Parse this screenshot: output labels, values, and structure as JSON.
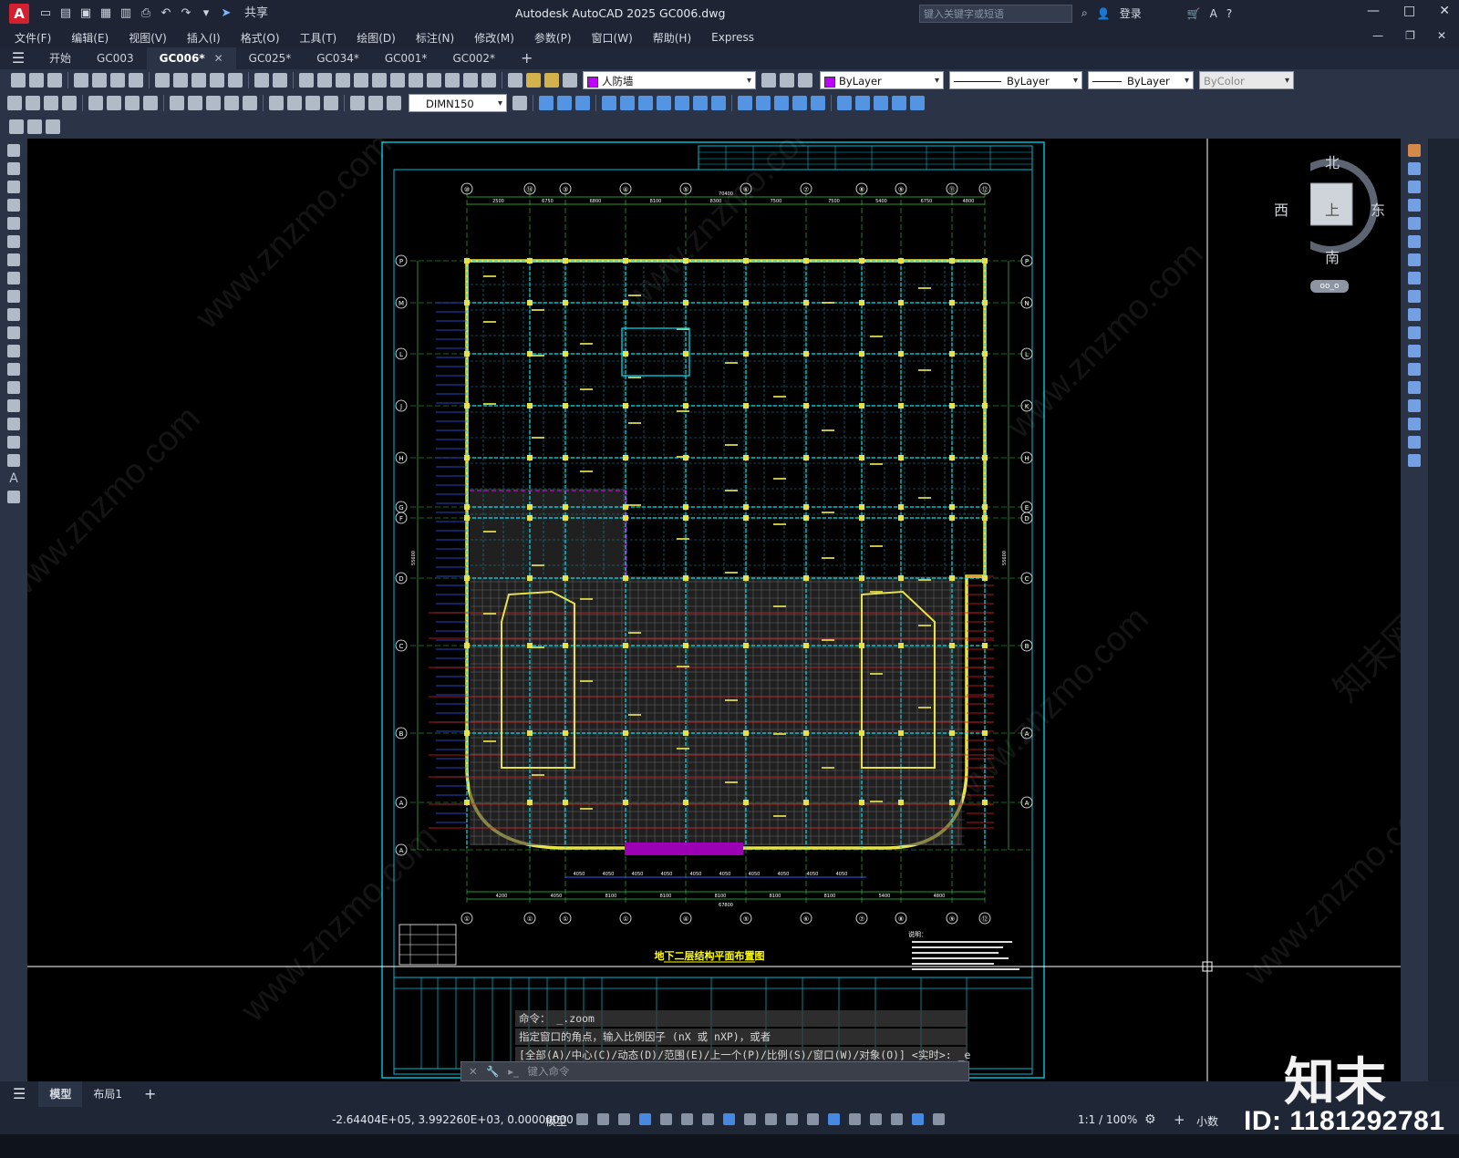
{
  "app": {
    "logo": "A",
    "title": "Autodesk AutoCAD 2025    GC006.dwg",
    "share": "共享",
    "search_placeholder": "键入关键字或短语",
    "login": "登录"
  },
  "menu": [
    "文件(F)",
    "编辑(E)",
    "视图(V)",
    "插入(I)",
    "格式(O)",
    "工具(T)",
    "绘图(D)",
    "标注(N)",
    "修改(M)",
    "参数(P)",
    "窗口(W)",
    "帮助(H)",
    "Express"
  ],
  "tabs": [
    {
      "label": "开始",
      "active": false
    },
    {
      "label": "GC003",
      "active": false
    },
    {
      "label": "GC006*",
      "active": true
    },
    {
      "label": "GC025*",
      "active": false
    },
    {
      "label": "GC034*",
      "active": false
    },
    {
      "label": "GC001*",
      "active": false
    },
    {
      "label": "GC002*",
      "active": false
    }
  ],
  "properties": {
    "layer": "人防墙",
    "color": "ByLayer",
    "linetype": "ByLayer",
    "lineweight": "ByLayer",
    "plotstyle": "ByColor",
    "dimstyle": "DIMN150"
  },
  "viewcube": {
    "north": "北",
    "south": "南",
    "east": "东",
    "west": "西",
    "top": "上",
    "wcs": "oo_o"
  },
  "drawing": {
    "title": "地下二层结构平面布置图",
    "grid_top": [
      "⑩",
      "⑭",
      "③",
      "④",
      "⑤",
      "⑥",
      "⑦",
      "⑧",
      "⑨",
      "⑪",
      "⑫"
    ],
    "grid_bottom": [
      "①",
      "①",
      "①",
      "①",
      "④",
      "⑤",
      "⑥",
      "⑦",
      "⑧",
      "⑨",
      "⑫"
    ],
    "grid_left": [
      "P",
      "M",
      "L",
      "J",
      "H",
      "G",
      "F",
      "D",
      "C",
      "B",
      "A",
      "A"
    ],
    "grid_right": [
      "P",
      "N",
      "L",
      "K",
      "H",
      "E",
      "D",
      "C",
      "B",
      "A",
      "A"
    ],
    "dim_top": [
      "2500",
      "6750",
      "6800",
      "8100",
      "8300",
      "7500",
      "7500",
      "5400",
      "6750",
      "4800"
    ],
    "dim_top_total": "70400",
    "dim_bottom": [
      "4200",
      "4050",
      "8100",
      "8100",
      "8100",
      "8100",
      "8100",
      "5400",
      "4800"
    ],
    "dim_bottom_total": "67800",
    "dim_lower": [
      "4050",
      "4050",
      "4050",
      "4050",
      "4050",
      "4050",
      "4050",
      "4050",
      "4050",
      "4050"
    ],
    "dim_right_total": "55600",
    "dim_left_total": "55600",
    "notes_heading": "说明："
  },
  "command": {
    "history": [
      "命令： _.zoom",
      "指定窗口的角点，输入比例因子 (nX 或 nXP)，或者",
      "[全部(A)/中心(C)/动态(D)/范围(E)/上一个(P)/比例(S)/窗口(W)/对象(O)] <实时>: _e"
    ],
    "placeholder": "键入命令"
  },
  "layout_tabs": [
    {
      "label": "模型",
      "active": true
    },
    {
      "label": "布局1",
      "active": false
    }
  ],
  "status": {
    "coords": "-2.64404E+05, 3.992260E+03, 0.00000000",
    "space": "模型",
    "scale": "1:1 / 100%",
    "units": "小数"
  },
  "watermark": {
    "brand": "知末",
    "id": "ID: 1181292781",
    "site": "www.znzmo.com",
    "cn": "知末网"
  }
}
